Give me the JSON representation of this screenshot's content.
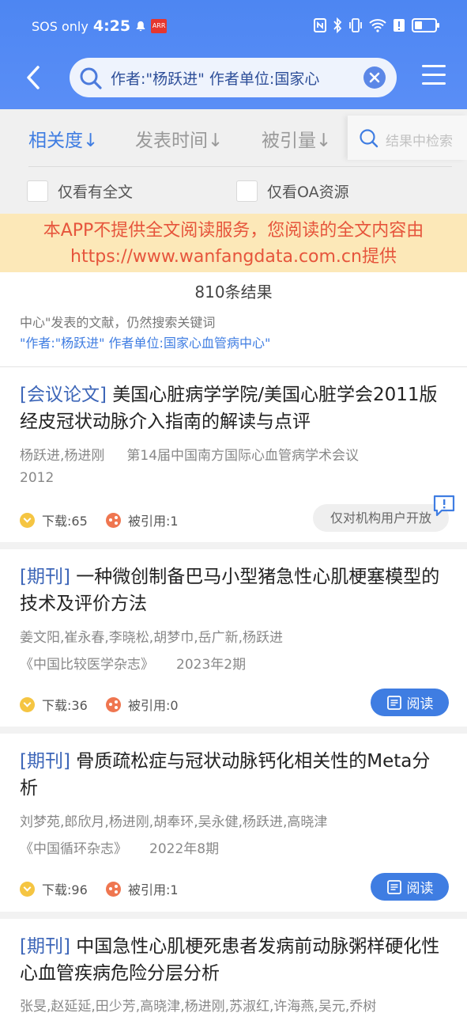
{
  "status_bar": {
    "carrier": "SOS only",
    "time": "4:25",
    "app_badge": "ARR"
  },
  "search": {
    "query": "作者:\"杨跃进\" 作者单位:国家心"
  },
  "sort": {
    "relevance": "相关度↓",
    "publish_time": "发表时间↓",
    "citations": "被引量↓",
    "search_in_results_placeholder": "结果中检索"
  },
  "filters": {
    "full_text_only": "仅看有全文",
    "oa_only": "仅看OA资源"
  },
  "notice": {
    "line1": "本APP不提供全文阅读服务，您阅读的全文内容由",
    "line2": "https://www.wanfangdata.com.cn提供"
  },
  "result_count": "810条结果",
  "search_tip": {
    "line1": "中心\"发表的文献，仍然搜索关键词",
    "line2": "\"作者:\"杨跃进\" 作者单位:国家心血管病中心\""
  },
  "results": [
    {
      "type": "[会议论文]",
      "title": "美国心脏病学学院/美国心脏学会2011版经皮冠状动脉介入指南的解读与点评",
      "authors": "杨跃进,杨进刚",
      "venue": "第14届中国南方国际心血管病学术会议",
      "year": "2012",
      "downloads": "下载:65",
      "citations": "被引用:1",
      "action": "仅对机构用户开放"
    },
    {
      "type": "[期刊]",
      "title": "一种微创制备巴马小型猪急性心肌梗塞模型的技术及评价方法",
      "authors": "姜文阳,崔永春,李晓松,胡梦巾,岳广新,杨跃进",
      "venue": "《中国比较医学杂志》",
      "year": "2023年2期",
      "downloads": "下载:36",
      "citations": "被引用:0",
      "action": "阅读"
    },
    {
      "type": "[期刊]",
      "title": "骨质疏松症与冠状动脉钙化相关性的Meta分析",
      "authors": "刘梦苑,郎欣月,杨进刚,胡奉环,吴永健,杨跃进,高晓津",
      "venue": "《中国循环杂志》",
      "year": "2022年8期",
      "downloads": "下载:96",
      "citations": "被引用:1",
      "action": "阅读"
    },
    {
      "type": "[期刊]",
      "title": "中国急性心肌梗死患者发病前动脉粥样硬化性心血管疾病危险分层分析",
      "authors": "张旻,赵延延,田少芳,高晓津,杨进刚,苏淑红,许海燕,吴元,乔树"
    }
  ],
  "colors": {
    "header": "#4d86f2",
    "accent": "#3f7de2",
    "type_label": "#3d66b8",
    "notice_bg": "#fce8b8",
    "notice_text": "#e6553c"
  }
}
